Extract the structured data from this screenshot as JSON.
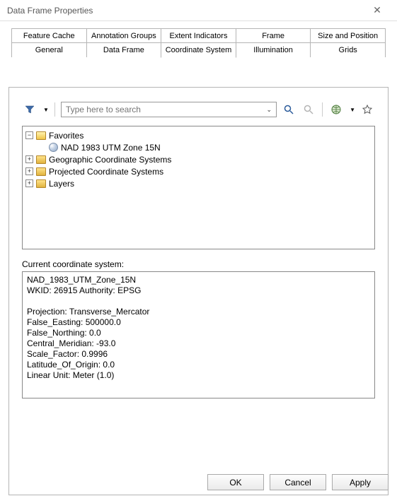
{
  "window": {
    "title": "Data Frame Properties"
  },
  "tabs_row1": [
    {
      "label": "Feature Cache"
    },
    {
      "label": "Annotation Groups"
    },
    {
      "label": "Extent Indicators"
    },
    {
      "label": "Frame"
    },
    {
      "label": "Size and Position"
    }
  ],
  "tabs_row2": [
    {
      "label": "General"
    },
    {
      "label": "Data Frame"
    },
    {
      "label": "Coordinate System",
      "active": true
    },
    {
      "label": "Illumination"
    },
    {
      "label": "Grids"
    }
  ],
  "search": {
    "placeholder": "Type here to search"
  },
  "tree": {
    "favorites_label": "Favorites",
    "favorite_item": "NAD 1983 UTM Zone 15N",
    "gcs_label": "Geographic Coordinate Systems",
    "pcs_label": "Projected Coordinate Systems",
    "layers_label": "Layers"
  },
  "section_label": "Current coordinate system:",
  "cs_details": "NAD_1983_UTM_Zone_15N\nWKID: 26915 Authority: EPSG\n\nProjection: Transverse_Mercator\nFalse_Easting: 500000.0\nFalse_Northing: 0.0\nCentral_Meridian: -93.0\nScale_Factor: 0.9996\nLatitude_Of_Origin: 0.0\nLinear Unit: Meter (1.0)",
  "buttons": {
    "ok": "OK",
    "cancel": "Cancel",
    "apply": "Apply"
  }
}
